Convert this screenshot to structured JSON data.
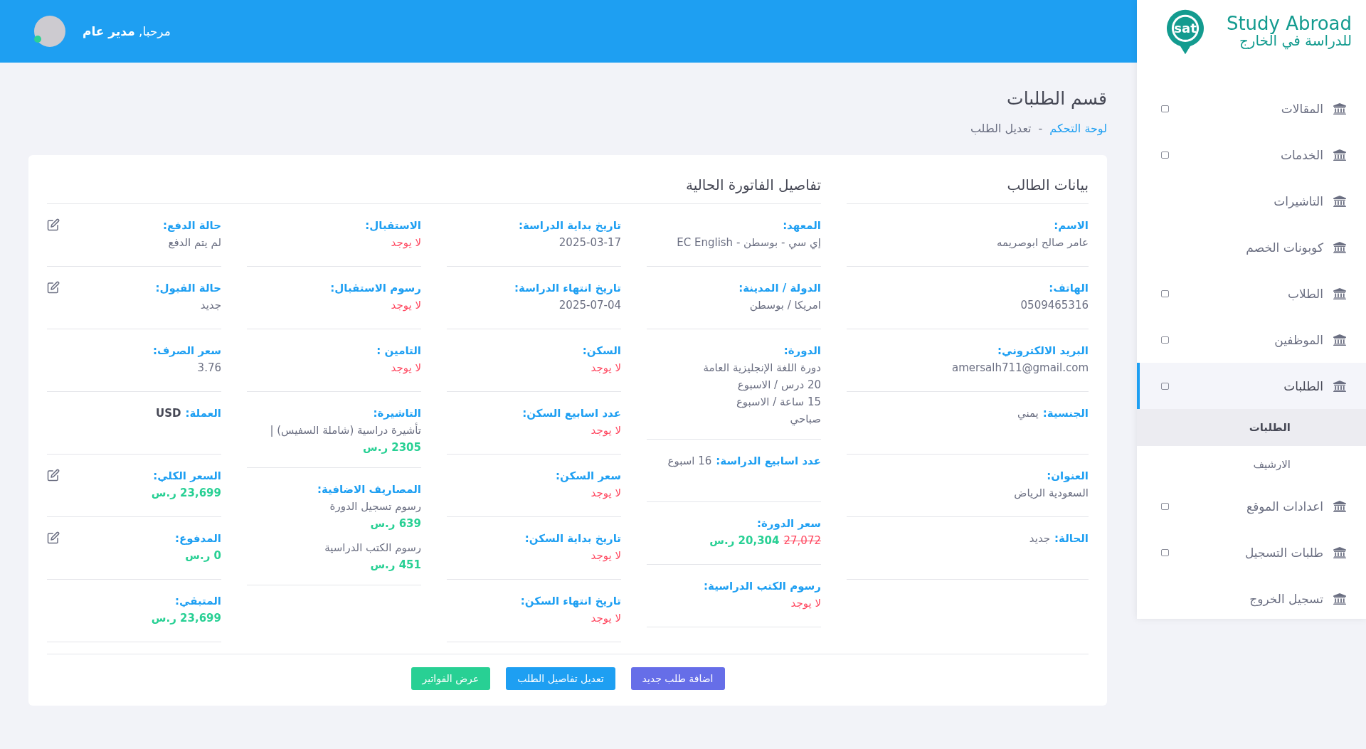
{
  "header": {
    "greeting": "مرحبا, **مدير عام**"
  },
  "logo": {
    "mark": "sat",
    "title": "Study Abroad",
    "subtitle": "للدراسة في الخارج"
  },
  "sidebar": {
    "items": [
      {
        "label": "المقالات",
        "toggle": true,
        "selected": false
      },
      {
        "label": "الخدمات",
        "toggle": true,
        "selected": false
      },
      {
        "label": "التاشيرات",
        "toggle": false,
        "selected": false
      },
      {
        "label": "كوبونات الخصم",
        "toggle": false,
        "selected": false
      },
      {
        "label": "الطلاب",
        "toggle": true,
        "selected": false
      },
      {
        "label": "الموظفين",
        "toggle": true,
        "selected": false
      },
      {
        "label": "الطلبات",
        "toggle": true,
        "selected": true,
        "children": [
          {
            "label": "الطلبات",
            "selected": true
          },
          {
            "label": "الارشيف",
            "selected": false
          }
        ]
      },
      {
        "label": "اعدادات الموقع",
        "toggle": true,
        "selected": false
      },
      {
        "label": "طلبات التسجيل",
        "toggle": true,
        "selected": false
      },
      {
        "label": "تسجيل الخروج",
        "toggle": false,
        "selected": false
      }
    ]
  },
  "page": {
    "title": "قسم الطلبات",
    "breadcrumb": [
      {
        "label": "لوحة التحكم",
        "link": true
      },
      {
        "label": "-",
        "link": false
      },
      {
        "label": "تعديل الطلب",
        "link": false
      }
    ]
  },
  "student": {
    "title": "بيانات الطالب",
    "fields": [
      {
        "label": "الاسم:",
        "inline": false,
        "lines": [
          [
            {
              "text": "عامر صالح ابوصريمه",
              "kind": "plain"
            }
          ]
        ]
      },
      {
        "label": "الهاتف:",
        "inline": false,
        "lines": [
          [
            {
              "text": "0509465316",
              "kind": "plain"
            }
          ]
        ]
      },
      {
        "label": "البريد الالكتروني:",
        "inline": false,
        "lines": [
          [
            {
              "text": "amersalh711@gmail.com",
              "kind": "plain"
            }
          ]
        ]
      },
      {
        "label": "الجنسية:",
        "inline": true,
        "lines": [
          [
            {
              "text": "يمني",
              "kind": "plain"
            }
          ]
        ]
      },
      {
        "label": "العنوان:",
        "inline": false,
        "lines": [
          [
            {
              "text": "السعودية الرياض",
              "kind": "plain"
            }
          ]
        ]
      },
      {
        "label": "الحالة:",
        "inline": true,
        "lines": [
          [
            {
              "text": "جديد",
              "kind": "plain"
            }
          ]
        ]
      }
    ]
  },
  "invoice": {
    "title": "تفاصيل الفاتورة الحالية",
    "columns": [
      [
        {
          "label": "المعهد:",
          "inline": false,
          "editable": false,
          "lines": [
            [
              {
                "text": "إي سي - بوسطن - EC English",
                "kind": "plain"
              }
            ]
          ]
        },
        {
          "label": "الدولة / المدينة:",
          "inline": false,
          "editable": false,
          "lines": [
            [
              {
                "text": "امريكا / بوسطن",
                "kind": "plain"
              }
            ]
          ]
        },
        {
          "label": "الدورة:",
          "inline": false,
          "editable": false,
          "lines": [
            [
              {
                "text": "دورة اللغة الإنجليزية العامة",
                "kind": "plain"
              }
            ],
            [
              {
                "text": "20 درس / الاسبوع",
                "kind": "plain"
              }
            ],
            [
              {
                "text": "15 ساعة / الاسبوع",
                "kind": "plain"
              }
            ],
            [
              {
                "text": "صباحي",
                "kind": "plain"
              }
            ]
          ]
        },
        {
          "label": "عدد اسابيع الدراسة:",
          "inline": true,
          "editable": false,
          "lines": [
            [
              {
                "text": "16 اسبوع",
                "kind": "plain"
              }
            ]
          ]
        },
        {
          "label": "سعر الدورة:",
          "inline": false,
          "editable": false,
          "lines": [
            [
              {
                "text": "27,072",
                "kind": "old"
              },
              {
                "text": "20,304 ر.س",
                "kind": "money"
              }
            ]
          ]
        },
        {
          "label": "رسوم الكتب الدراسية:",
          "inline": false,
          "editable": false,
          "lines": [
            [
              {
                "text": "لا يوجد",
                "kind": "missing"
              }
            ]
          ]
        }
      ],
      [
        {
          "label": "تاريخ بداية الدراسة:",
          "inline": false,
          "editable": false,
          "lines": [
            [
              {
                "text": "2025-03-17",
                "kind": "plain"
              }
            ]
          ]
        },
        {
          "label": "تاريخ انتهاء الدراسة:",
          "inline": false,
          "editable": false,
          "lines": [
            [
              {
                "text": "2025-07-04",
                "kind": "plain"
              }
            ]
          ]
        },
        {
          "label": "السكن:",
          "inline": false,
          "editable": false,
          "lines": [
            [
              {
                "text": "لا يوجد",
                "kind": "missing"
              }
            ]
          ]
        },
        {
          "label": "عدد اسابيع السكن:",
          "inline": false,
          "editable": false,
          "lines": [
            [
              {
                "text": "لا يوجد",
                "kind": "missing"
              }
            ]
          ]
        },
        {
          "label": "سعر السكن:",
          "inline": false,
          "editable": false,
          "lines": [
            [
              {
                "text": "لا يوجد",
                "kind": "missing"
              }
            ]
          ]
        },
        {
          "label": "تاريخ بداية السكن:",
          "inline": false,
          "editable": false,
          "lines": [
            [
              {
                "text": "لا يوجد",
                "kind": "missing"
              }
            ]
          ]
        },
        {
          "label": "تاريخ انتهاء السكن:",
          "inline": false,
          "editable": false,
          "lines": [
            [
              {
                "text": "لا يوجد",
                "kind": "missing"
              }
            ]
          ]
        }
      ],
      [
        {
          "label": "الاستقبال:",
          "inline": false,
          "editable": false,
          "lines": [
            [
              {
                "text": "لا يوجد",
                "kind": "missing"
              }
            ]
          ]
        },
        {
          "label": "رسوم الاستقبال:",
          "inline": false,
          "editable": false,
          "lines": [
            [
              {
                "text": "لا يوجد",
                "kind": "missing"
              }
            ]
          ]
        },
        {
          "label": "التامين :",
          "inline": false,
          "editable": false,
          "lines": [
            [
              {
                "text": "لا يوجد",
                "kind": "missing"
              }
            ]
          ]
        },
        {
          "label": "التاشيرة:",
          "inline": false,
          "editable": false,
          "lines": [
            [
              {
                "text": "تأشيرة دراسية (شاملة السفيس) |",
                "kind": "plain"
              }
            ],
            [
              {
                "text": "2305 ر.س",
                "kind": "money"
              }
            ]
          ]
        },
        {
          "label": "المصاريف الاضافية:",
          "inline": false,
          "editable": false,
          "lines": [
            [
              {
                "text": "رسوم تسجيل الدورة",
                "kind": "plain"
              }
            ],
            [
              {
                "text": "639 ر.س",
                "kind": "money"
              }
            ],
            [
              {
                "text": "رسوم الكتب الدراسية",
                "kind": "plain"
              }
            ],
            [
              {
                "text": "451 ر.س",
                "kind": "money"
              }
            ]
          ]
        }
      ],
      [
        {
          "label": "حالة الدفع:",
          "inline": false,
          "editable": true,
          "lines": [
            [
              {
                "text": "لم يتم الدفع",
                "kind": "plain"
              }
            ]
          ]
        },
        {
          "label": "حالة القبول:",
          "inline": false,
          "editable": true,
          "lines": [
            [
              {
                "text": "جديد",
                "kind": "plain"
              }
            ]
          ]
        },
        {
          "label": "سعر الصرف:",
          "inline": false,
          "editable": false,
          "lines": [
            [
              {
                "text": "3.76",
                "kind": "plain"
              }
            ]
          ]
        },
        {
          "label": "العملة:",
          "inline": true,
          "editable": false,
          "lines": [
            [
              {
                "text": "USD",
                "kind": "bold"
              }
            ]
          ]
        },
        {
          "label": "السعر الكلي:",
          "inline": false,
          "editable": true,
          "lines": [
            [
              {
                "text": "23,699 ر.س",
                "kind": "money"
              }
            ]
          ]
        },
        {
          "label": "المدفوع:",
          "inline": false,
          "editable": true,
          "lines": [
            [
              {
                "text": "0 ر.س",
                "kind": "money"
              }
            ]
          ]
        },
        {
          "label": "المتبقي:",
          "inline": false,
          "editable": false,
          "lines": [
            [
              {
                "text": "23,699 ر.س",
                "kind": "money"
              }
            ]
          ]
        }
      ]
    ]
  },
  "buttons": [
    {
      "label": "اضافة طلب جديد",
      "kind": "add"
    },
    {
      "label": "تعديل تفاصيل الطلب",
      "kind": "edit"
    },
    {
      "label": "عرض الفواتير",
      "kind": "invoices"
    }
  ]
}
